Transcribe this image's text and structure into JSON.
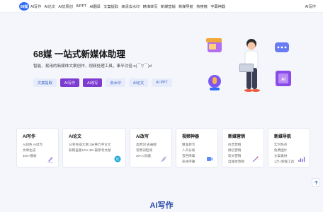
{
  "nav": {
    "logo_text": "68媒",
    "items": [
      "AI写作",
      "AI论文",
      "AI仿原创",
      "AIPPT",
      "AI翻译",
      "文案提取",
      "高清去水印",
      "精准转写",
      "新媒营销",
      "新媒导航",
      "热搜榜",
      "字幕神器"
    ],
    "right_label": "AI写作"
  },
  "hero": {
    "title": "68媒 一站式新媒体助理",
    "subtitle": "智能、易用的新媒体文案创作、视频处理工具，事半功倍 o(￣▽￣)d",
    "chips": [
      {
        "label": "文案提取",
        "active": false
      },
      {
        "label": "AI写作",
        "active": true
      },
      {
        "label": "AI改写",
        "active": true
      },
      {
        "label": "去水印",
        "active": false
      },
      {
        "label": "AI论文",
        "active": false
      },
      {
        "label": "AI PPT",
        "active": false
      }
    ]
  },
  "cards": [
    {
      "title": "AI写作",
      "lines": [
        "AI润色  AI续写",
        "文章生成",
        "400+模板"
      ],
      "icon": "pen-icon"
    },
    {
      "title": "AI论文",
      "lines": [
        "10秒生成大纲  3分钟万字论文",
        "知网查重10%  30+篇参考文献"
      ],
      "icon": "paper-badge-icon"
    },
    {
      "title": "AI改写",
      "lines": [
        "高原创  史通顺",
        "常用词检测",
        "30+AI功能"
      ],
      "icon": "feather-icon"
    },
    {
      "title": "视频神器",
      "lines": [
        "精准转写",
        "人声分离",
        "音色降噪",
        "在线字幕"
      ],
      "icon": "magic-video-icon"
    },
    {
      "title": "新媒营销",
      "lines": [
        "抖音营销",
        "微信营销",
        "软文营销",
        "自媒体营销"
      ],
      "icon": "wand-icon"
    },
    {
      "title": "新媒导航",
      "lines": [
        "实时热点",
        "免费图片",
        "文案素材",
        "1万+新媒工具"
      ],
      "icon": "chart-icon"
    }
  ],
  "section": {
    "title": "AI写作"
  },
  "colors": {
    "accent": "#7d3bd1",
    "brand": "#2f6df6",
    "heading": "#2a49a8"
  }
}
